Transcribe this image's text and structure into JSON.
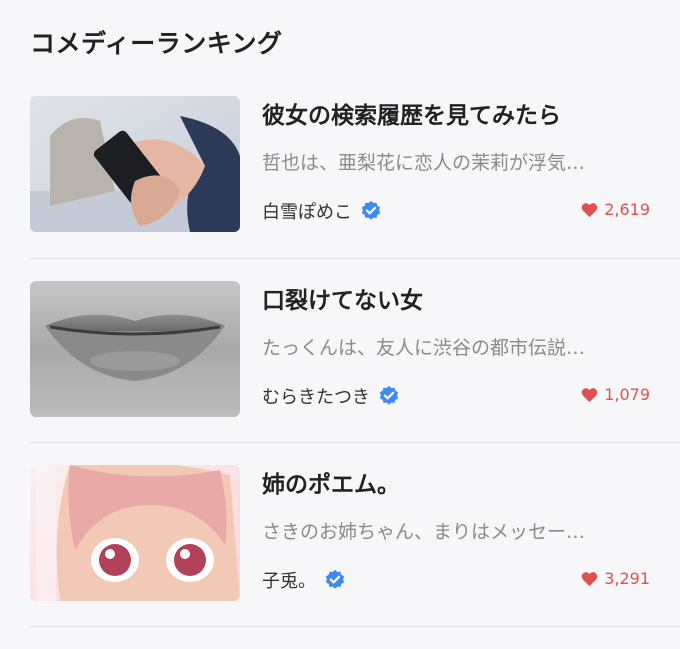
{
  "section": {
    "title": "コメディーランキング"
  },
  "items": [
    {
      "title": "彼女の検索履歴を見てみたら",
      "description": "哲也は、亜梨花に恋人の茉莉が浮気…",
      "author": "白雪ぽめこ",
      "likes": "2,619",
      "thumbnail_icon": "hands-holding-phone-image"
    },
    {
      "title": "口裂けてない女",
      "description": "たっくんは、友人に渋谷の都市伝説…",
      "author": "むらきたつき",
      "likes": "1,079",
      "thumbnail_icon": "lips-closeup-image"
    },
    {
      "title": "姉のポエム。",
      "description": "さきのお姉ちゃん、まりはメッセー…",
      "author": "子兎。",
      "likes": "3,291",
      "thumbnail_icon": "anime-girl-image"
    }
  ],
  "colors": {
    "accent_heart": "#e05050",
    "verified": "#3d8af7"
  }
}
